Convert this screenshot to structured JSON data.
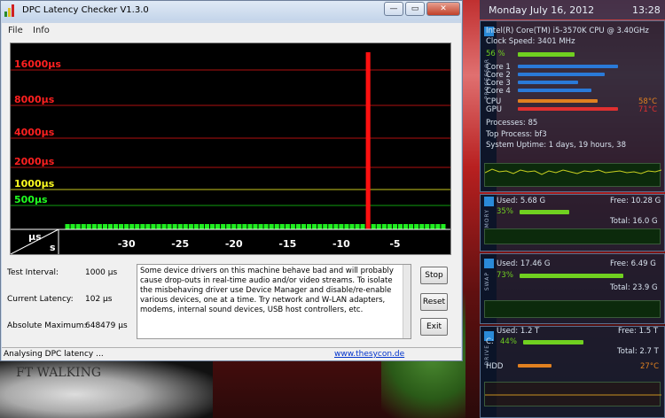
{
  "window": {
    "title": "DPC Latency Checker V1.3.0",
    "controls": {
      "minimize": "—",
      "maximize": "▭",
      "close": "✕"
    }
  },
  "menu": [
    "File",
    "Info"
  ],
  "chart_data": {
    "type": "bar",
    "y_labels": [
      {
        "label": "16000µs",
        "value": 16000,
        "color": "#ff2020"
      },
      {
        "label": "8000µs",
        "value": 8000,
        "color": "#ff2020"
      },
      {
        "label": "4000µs",
        "value": 4000,
        "color": "#ff2020"
      },
      {
        "label": "2000µs",
        "value": 2000,
        "color": "#ff2020"
      },
      {
        "label": "1000µs",
        "value": 1000,
        "color": "#ffff20"
      },
      {
        "label": "500µs",
        "value": 500,
        "color": "#20ff20"
      }
    ],
    "y_unit": "µs",
    "x_unit": "s",
    "x_ticks": [
      "-30",
      "-25",
      "-20",
      "-15",
      "-10",
      "-5"
    ],
    "x_range": [
      -36,
      0
    ],
    "bars": [
      {
        "x": -35.5,
        "value": 150
      },
      {
        "x": -35,
        "value": 170
      },
      {
        "x": -34.5,
        "value": 160
      },
      {
        "x": -34,
        "value": 200
      },
      {
        "x": -33.5,
        "value": 170
      },
      {
        "x": -33,
        "value": 150
      },
      {
        "x": -32.5,
        "value": 200
      },
      {
        "x": -32,
        "value": 180
      },
      {
        "x": -31.5,
        "value": 160
      },
      {
        "x": -31,
        "value": 170
      },
      {
        "x": -30.5,
        "value": 200
      },
      {
        "x": -30,
        "value": 150
      },
      {
        "x": -29.5,
        "value": 180
      },
      {
        "x": -29,
        "value": 170
      },
      {
        "x": -28.5,
        "value": 150
      },
      {
        "x": -28,
        "value": 160
      },
      {
        "x": -27.5,
        "value": 190
      },
      {
        "x": -27,
        "value": 150
      },
      {
        "x": -26.5,
        "value": 160
      },
      {
        "x": -26,
        "value": 190
      },
      {
        "x": -25.5,
        "value": 170
      },
      {
        "x": -25,
        "value": 150
      },
      {
        "x": -24.5,
        "value": 160
      },
      {
        "x": -24,
        "value": 200
      },
      {
        "x": -23.5,
        "value": 150
      },
      {
        "x": -23,
        "value": 170
      },
      {
        "x": -22.5,
        "value": 190
      },
      {
        "x": -22,
        "value": 160
      },
      {
        "x": -21.5,
        "value": 150
      },
      {
        "x": -21,
        "value": 180
      },
      {
        "x": -20.5,
        "value": 170
      },
      {
        "x": -20,
        "value": 160
      },
      {
        "x": -19.5,
        "value": 150
      },
      {
        "x": -19,
        "value": 190
      },
      {
        "x": -18.5,
        "value": 160
      },
      {
        "x": -18,
        "value": 170
      },
      {
        "x": -17.5,
        "value": 150
      },
      {
        "x": -17,
        "value": 180
      },
      {
        "x": -16.5,
        "value": 200
      },
      {
        "x": -16,
        "value": 160
      },
      {
        "x": -15.5,
        "value": 150
      },
      {
        "x": -15,
        "value": 170
      },
      {
        "x": -14.5,
        "value": 180
      },
      {
        "x": -14,
        "value": 160
      },
      {
        "x": -13.5,
        "value": 150
      },
      {
        "x": -13,
        "value": 170
      },
      {
        "x": -12.5,
        "value": 190
      },
      {
        "x": -12,
        "value": 150
      },
      {
        "x": -11.5,
        "value": 170
      },
      {
        "x": -11,
        "value": 160
      },
      {
        "x": -10.5,
        "value": 150
      },
      {
        "x": -10,
        "value": 180
      },
      {
        "x": -9.5,
        "value": 160
      },
      {
        "x": -9,
        "value": 150
      },
      {
        "x": -8.5,
        "value": 170
      },
      {
        "x": -8,
        "value": 190
      },
      {
        "x": -7.5,
        "value": 648479
      },
      {
        "x": -7,
        "value": 170
      },
      {
        "x": -6.5,
        "value": 160
      },
      {
        "x": -6,
        "value": 180
      },
      {
        "x": -5.5,
        "value": 150
      },
      {
        "x": -5,
        "value": 170
      },
      {
        "x": -4.5,
        "value": 200
      },
      {
        "x": -4,
        "value": 160
      },
      {
        "x": -3.5,
        "value": 180
      },
      {
        "x": -3,
        "value": 150
      },
      {
        "x": -2.5,
        "value": 170
      },
      {
        "x": -2,
        "value": 190
      },
      {
        "x": -1.5,
        "value": 160
      },
      {
        "x": -1,
        "value": 150
      },
      {
        "x": -0.5,
        "value": 180
      }
    ],
    "colors": {
      "normal": "#20ee20",
      "spike": "#ff1010",
      "grid_red": "#b01010",
      "grid_yellow": "#c8c820",
      "grid_green": "#10a010"
    }
  },
  "info": {
    "test_interval_label": "Test Interval:",
    "test_interval_value": "1000 µs",
    "current_latency_label": "Current Latency:",
    "current_latency_value": "102 µs",
    "absolute_max_label": "Absolute Maximum:",
    "absolute_max_value": "648479 µs",
    "description": "Some device drivers on this machine behave bad and will probably cause drop-outs in real-time audio and/or video streams. To isolate the misbehaving driver use Device Manager and disable/re-enable various devices, one at a time. Try network and W-LAN adapters, modems, internal sound devices, USB host controllers, etc."
  },
  "buttons": {
    "stop": "Stop",
    "reset": "Reset",
    "exit": "Exit"
  },
  "status": {
    "text": "Analysing DPC latency ...",
    "link": "www.thesycon.de"
  },
  "gadget": {
    "date": "Monday July 16, 2012",
    "time": "13:28",
    "processor": {
      "side_label": "PROCESSOR",
      "cpu_name": "Intel(R) Core(TM) i5-3570K CPU @ 3.40GHz",
      "clock": "Clock Speed: 3401 MHz",
      "usage": "56 %",
      "usage_level": 0.56,
      "cores": [
        {
          "label": "Core 1",
          "level": 0.75
        },
        {
          "label": "Core 2",
          "level": 0.65
        },
        {
          "label": "Core 3",
          "level": 0.45
        },
        {
          "label": "Core 4",
          "level": 0.55
        }
      ],
      "cpu_label": "CPU",
      "cpu_temp": "58°C",
      "cpu_level": 0.6,
      "gpu_label": "GPU",
      "gpu_temp": "71°C",
      "gpu_level": 0.75,
      "processes": "Processes: 85",
      "top_process": "Top Process: bf3",
      "uptime": "System Uptime: 1 days, 19 hours, 38"
    },
    "memory": {
      "side_label": "MEMORY",
      "used": "Used: 5.68 G",
      "free": "Free: 10.28 G",
      "percent": "35%",
      "level": 0.35,
      "total": "Total: 16.0 G"
    },
    "swap": {
      "side_label": "SWAP",
      "used": "Used: 17.46 G",
      "free": "Free: 6.49 G",
      "percent": "73%",
      "level": 0.73,
      "total": "Total: 23.9 G"
    },
    "drive": {
      "side_label": "DRIVE",
      "used": "Used: 1.2 T",
      "free": "Free: 1.5 T",
      "letter": "C:",
      "percent": "44%",
      "level": 0.44,
      "total": "Total: 2.7 T",
      "hdd_label": "HDD",
      "hdd_temp": "27°C",
      "hdd_level": 0.25
    }
  },
  "desktop": {
    "coin_text": "FT WALKING"
  }
}
